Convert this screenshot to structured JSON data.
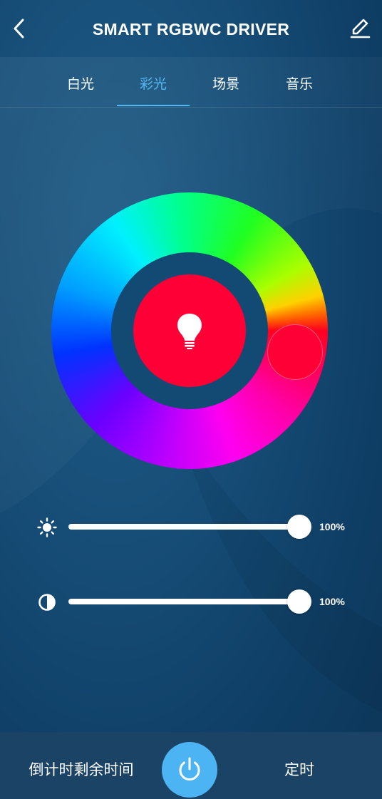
{
  "header": {
    "title": "SMART RGBWC DRIVER",
    "back_icon": "chevron-left-icon",
    "edit_icon": "pencil-icon"
  },
  "tabs": [
    {
      "label": "白光",
      "active": false
    },
    {
      "label": "彩光",
      "active": true
    },
    {
      "label": "场景",
      "active": false
    },
    {
      "label": "音乐",
      "active": false
    }
  ],
  "color_picker": {
    "selected_color": "#ff0036",
    "center_icon": "light-bulb-icon"
  },
  "sliders": {
    "brightness": {
      "icon": "sun-icon",
      "value": 1.0,
      "label": "100%"
    },
    "saturation": {
      "icon": "contrast-icon",
      "value": 1.0,
      "label": "100%"
    }
  },
  "bottom_bar": {
    "countdown_label": "倒计时剩余时间",
    "power_icon": "power-icon",
    "timer_label": "定时"
  },
  "colors": {
    "accent": "#52b8f0",
    "power_button": "#4cb4f3",
    "selected_color": "#ff0036",
    "background": "#174f79"
  }
}
